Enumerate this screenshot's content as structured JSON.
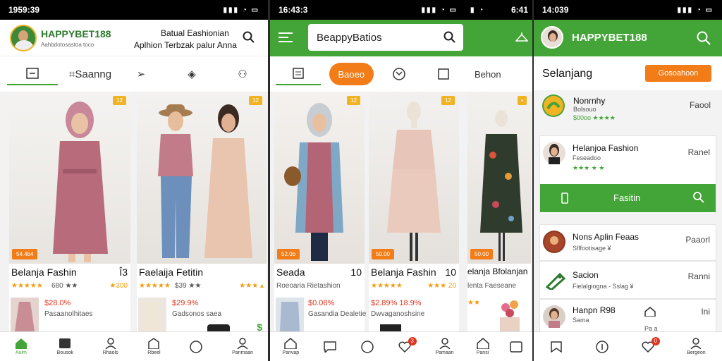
{
  "colors": {
    "green": "#43a437",
    "orange": "#f27c18",
    "star": "#f39c12",
    "price": "#e0341e"
  },
  "s1": {
    "time": "1959:39",
    "logo": "HAPPYBET188",
    "logo_sub": "Aahbdotosastoa toco",
    "header_line1": "Batual Eashionian",
    "header_line2": "Aplhion Terbzak palur Anna",
    "tabs": [
      "",
      "Saanng",
      "",
      "",
      ""
    ],
    "products": [
      {
        "badge_top": "12",
        "badge_bot": "54.4b4",
        "title": "Belanja Fashin",
        "title_right": "Î3",
        "stars": "★★★★★",
        "rating": "680 ★★",
        "rating_right": "★300",
        "price": "$28.0%",
        "price_sub": "Pasaanolhitaes"
      },
      {
        "badge_top": "12",
        "title": "Faelaija Fetitin",
        "title_right": "",
        "stars": "★★★★★",
        "rating": "$39 ★★",
        "price": "$29.9%",
        "price_sub": "Gadsonos saea"
      }
    ],
    "nav": [
      "Auim",
      "Bousok",
      "Rhaols",
      "Rbeel",
      "",
      "Panmaan"
    ]
  },
  "s2": {
    "time": "16:43:3",
    "search_value": "BeappyBatios",
    "active_tab": "Baoeo",
    "products": [
      {
        "badge_top": "12",
        "badge_bot": "52.0b",
        "title": "Seada",
        "title_right": "10",
        "sub": "Roeoaria Rietashion",
        "price": "$0.08%",
        "price_sub": "Gasandia Dealetie"
      },
      {
        "badge_top": "12",
        "badge_bot": "50.00",
        "title": "Belanja Fashin",
        "title_right": "10",
        "stars": "★★★★★",
        "rating": "★★★ 20",
        "price": "$2.89% 18.9%",
        "price_sub": "Dwvaganoshsine"
      }
    ],
    "nav_badge": "3",
    "nav": [
      "Panvap",
      "",
      "",
      "",
      "Pamaan"
    ]
  },
  "s3": {
    "time": "6:41",
    "tab_label": "Behon",
    "badge_bot": "50.00",
    "title": "elanja Bfolanjan",
    "sub": "lenta Faeseane",
    "nav": [
      "Pansi"
    ]
  },
  "s4": {
    "time": "14:039",
    "logo": "HAPPYBET188",
    "heading": "Selanjang",
    "cta": "Gosoahoon",
    "rows": [
      {
        "name": "Nonrnhy",
        "sub1": "Bolsouo",
        "sub2": "$00oo ★★★★",
        "right": "Faool"
      },
      {
        "name": "Helanjoa Fashion",
        "sub1": "Feseadoo",
        "sub2": "★★★ ★ ★",
        "right": "Ranel"
      },
      {
        "name": "Nons Aplin Feaas",
        "sub1": "Sflfootisage ¥",
        "right": "Paaorl"
      },
      {
        "name": "Sacion",
        "sub1": "Fielalgiogna - Sslag ¥",
        "right": "Ranni"
      },
      {
        "name": "Hanpn R98",
        "sub1": "Sama",
        "sub2": "Pa a",
        "right": "Ini"
      }
    ],
    "featured": "Fasitin",
    "nav_badge": "0",
    "nav": [
      "",
      "",
      "",
      "Bergeon"
    ]
  }
}
